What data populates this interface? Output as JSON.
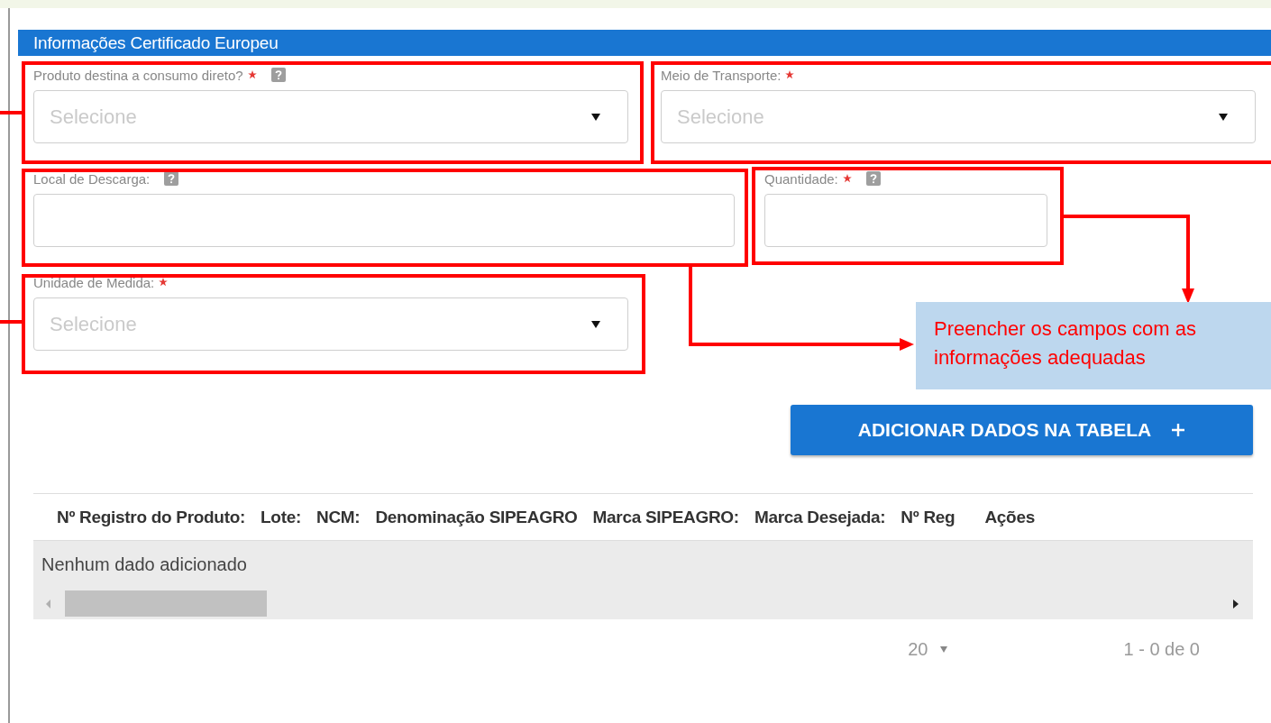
{
  "section": {
    "title": "Informações Certificado Europeu"
  },
  "fields": [
    {
      "label": "Produto destina a consumo direto?",
      "required": true,
      "help": true,
      "kind": "select",
      "placeholder": "Selecione"
    },
    {
      "label": "Meio de Transporte:",
      "required": true,
      "help": false,
      "kind": "select",
      "placeholder": "Selecione"
    },
    {
      "label": "Local de Descarga:",
      "required": false,
      "help": true,
      "kind": "text"
    },
    {
      "label": "Quantidade:",
      "required": true,
      "help": true,
      "kind": "text"
    },
    {
      "label": "Unidade de Medida:",
      "required": true,
      "help": false,
      "kind": "select",
      "placeholder": "Selecione"
    }
  ],
  "add_button": {
    "label": "ADICIONAR DADOS NA TABELA"
  },
  "table": {
    "columns": [
      "Nº Registro do Produto:",
      "Lote:",
      "NCM:",
      "Denominação SIPEAGRO",
      "Marca SIPEAGRO:",
      "Marca Desejada:",
      "Nº Reg",
      "Ações"
    ],
    "empty_message": "Nenhum dado adicionado"
  },
  "pagination": {
    "page_size": "20",
    "range": "1 - 0 de 0"
  },
  "annotation": {
    "note": "Preencher os campos com as informações adequadas"
  }
}
